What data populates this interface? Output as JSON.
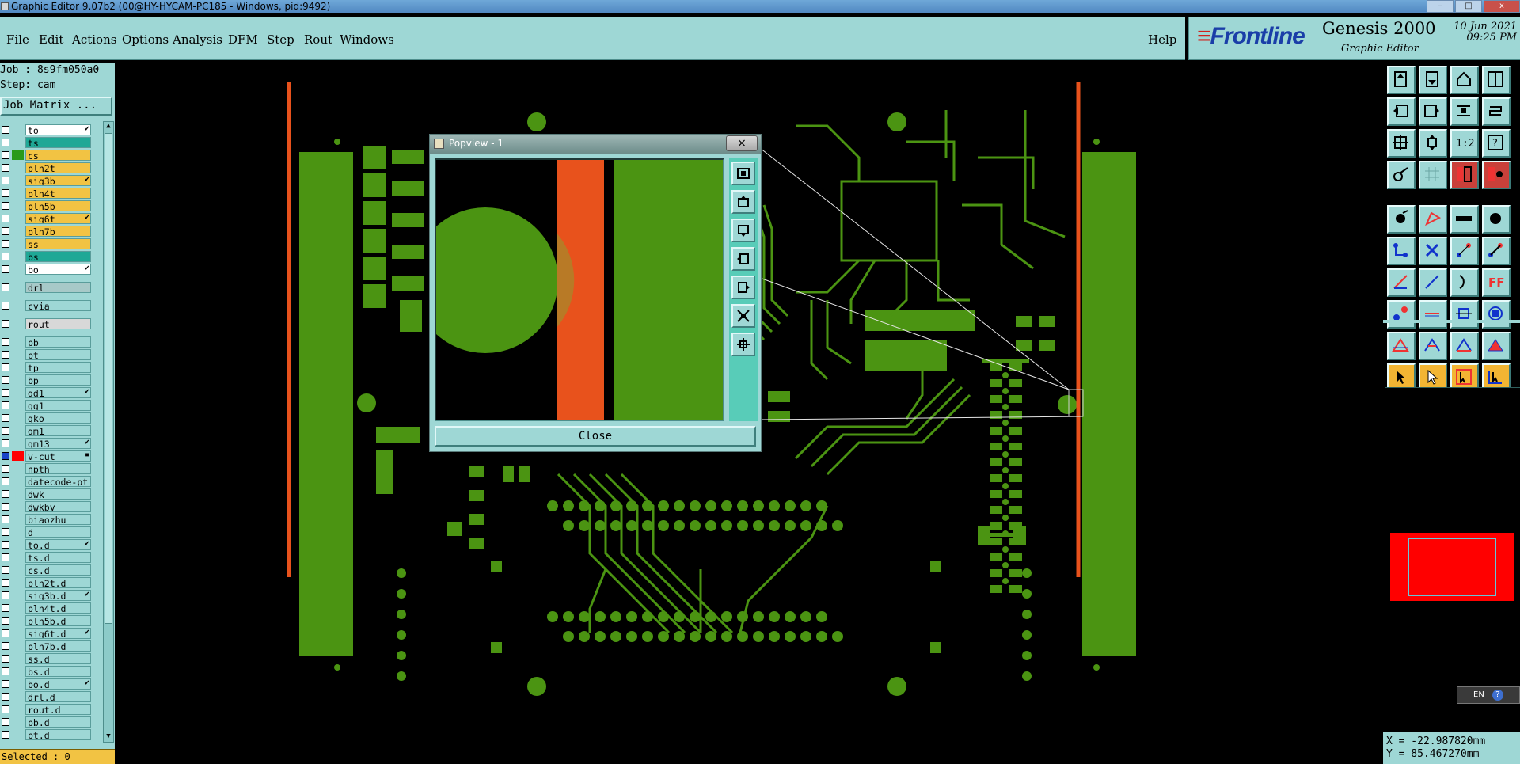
{
  "window": {
    "title": "Graphic Editor 9.07b2 (00@HY-HYCAM-PC185 - Windows, pid:9492)",
    "controls": [
      "–",
      "□",
      "x"
    ]
  },
  "menu": {
    "items": [
      "File",
      "Edit",
      "Actions",
      "Options",
      "Analysis",
      "DFM",
      "Step",
      "Rout",
      "Windows"
    ],
    "help": "Help"
  },
  "brand": {
    "logo": "Frontline",
    "product": "Genesis 2000",
    "subtitle": "Graphic Editor",
    "date": "10 Jun 2021",
    "time": "09:25 PM"
  },
  "job": {
    "job_label": "Job : 8s9fm050a0",
    "step_label": "Step: cam",
    "matrix_button": "Job Matrix ..."
  },
  "layers": [
    {
      "name": "to",
      "color": "#ffffff",
      "mark": "✔"
    },
    {
      "name": "ts",
      "color": "#1fa896",
      "mark": ""
    },
    {
      "name": "cs",
      "color": "#f2c343",
      "mark": "",
      "active": true
    },
    {
      "name": "pln2t",
      "color": "#f2c343",
      "mark": ""
    },
    {
      "name": "sig3b",
      "color": "#f2c343",
      "mark": "✔"
    },
    {
      "name": "pln4t",
      "color": "#f2c343",
      "mark": ""
    },
    {
      "name": "pln5b",
      "color": "#f2c343",
      "mark": ""
    },
    {
      "name": "sig6t",
      "color": "#f2c343",
      "mark": "✔"
    },
    {
      "name": "pln7b",
      "color": "#f2c343",
      "mark": ""
    },
    {
      "name": "ss",
      "color": "#f2c343",
      "mark": ""
    },
    {
      "name": "bs",
      "color": "#1fa896",
      "mark": ""
    },
    {
      "name": "bo",
      "color": "#ffffff",
      "mark": "✔"
    },
    {
      "name": "drl",
      "color": "#a7c9c8",
      "mark": "",
      "gap": true
    },
    {
      "name": "cvia",
      "color": "#9ed7d5",
      "mark": "",
      "gap": true
    },
    {
      "name": "rout",
      "color": "#d8d8d8",
      "mark": "",
      "gap": true
    },
    {
      "name": "pb",
      "color": "#9ed7d5",
      "mark": "",
      "gap": true
    },
    {
      "name": "pt",
      "color": "#9ed7d5",
      "mark": ""
    },
    {
      "name": "tp",
      "color": "#9ed7d5",
      "mark": ""
    },
    {
      "name": "bp",
      "color": "#9ed7d5",
      "mark": ""
    },
    {
      "name": "gd1",
      "color": "#9ed7d5",
      "mark": "✔"
    },
    {
      "name": "gg1",
      "color": "#9ed7d5",
      "mark": ""
    },
    {
      "name": "gko",
      "color": "#9ed7d5",
      "mark": ""
    },
    {
      "name": "gm1",
      "color": "#9ed7d5",
      "mark": ""
    },
    {
      "name": "gm13",
      "color": "#9ed7d5",
      "mark": "✔"
    },
    {
      "name": "v-cut",
      "color": "#9ed7d5",
      "mark": "▪",
      "selected": true
    },
    {
      "name": "npth",
      "color": "#9ed7d5",
      "mark": ""
    },
    {
      "name": "datecode-pt",
      "color": "#9ed7d5",
      "mark": ""
    },
    {
      "name": "dwk",
      "color": "#9ed7d5",
      "mark": ""
    },
    {
      "name": "dwkby",
      "color": "#9ed7d5",
      "mark": ""
    },
    {
      "name": "biaozhu",
      "color": "#9ed7d5",
      "mark": ""
    },
    {
      "name": "d",
      "color": "#9ed7d5",
      "mark": ""
    },
    {
      "name": "to.d",
      "color": "#9ed7d5",
      "mark": "✔"
    },
    {
      "name": "ts.d",
      "color": "#9ed7d5",
      "mark": ""
    },
    {
      "name": "cs.d",
      "color": "#9ed7d5",
      "mark": ""
    },
    {
      "name": "pln2t.d",
      "color": "#9ed7d5",
      "mark": ""
    },
    {
      "name": "sig3b.d",
      "color": "#9ed7d5",
      "mark": "✔"
    },
    {
      "name": "pln4t.d",
      "color": "#9ed7d5",
      "mark": ""
    },
    {
      "name": "pln5b.d",
      "color": "#9ed7d5",
      "mark": ""
    },
    {
      "name": "sig6t.d",
      "color": "#9ed7d5",
      "mark": "✔"
    },
    {
      "name": "pln7b.d",
      "color": "#9ed7d5",
      "mark": ""
    },
    {
      "name": "ss.d",
      "color": "#9ed7d5",
      "mark": ""
    },
    {
      "name": "bs.d",
      "color": "#9ed7d5",
      "mark": ""
    },
    {
      "name": "bo.d",
      "color": "#9ed7d5",
      "mark": "✔"
    },
    {
      "name": "drl.d",
      "color": "#9ed7d5",
      "mark": ""
    },
    {
      "name": "rout.d",
      "color": "#9ed7d5",
      "mark": ""
    },
    {
      "name": "pb.d",
      "color": "#9ed7d5",
      "mark": ""
    },
    {
      "name": "pt.d",
      "color": "#9ed7d5",
      "mark": ""
    }
  ],
  "selected_label": "Selected : 0",
  "popview": {
    "title": "Popview - 1",
    "close_x": "×",
    "close_button": "Close"
  },
  "toolbar": {
    "icons": [
      "layer-up-icon",
      "layer-down-icon",
      "home-icon",
      "window-icon",
      "pan-left-icon",
      "pan-right-icon",
      "zoom-fit-icon",
      "redraw-icon",
      "zoom-home-icon",
      "zoom-window-icon",
      "scale-1to2-icon",
      "help-icon",
      "measure-icon",
      "grid-icon",
      "snap-icon",
      "snap-center-icon",
      "add-pad-icon",
      "add-surface-icon",
      "add-line-icon",
      "add-circle-icon",
      "connect-icon",
      "delete-icon",
      "move-icon",
      "copy-icon",
      "add-arc-icon",
      "line-icon",
      "arc-icon",
      "text-icon",
      "feature-select-icon",
      "cut-icon",
      "resize-icon",
      "transform-icon",
      "polygon-icon",
      "polyline-icon",
      "outline-icon",
      "fill-icon",
      "select-icon",
      "select-add-icon",
      "select-box-icon",
      "select-net-icon"
    ]
  },
  "ime": {
    "label": "EN",
    "help": "?"
  },
  "coords": {
    "x": "X = -22.987820mm",
    "y": "Y = 85.467270mm"
  },
  "colors": {
    "panel": "#9ed7d5",
    "copper": "#4b9412",
    "rout": "#e8521c",
    "selected_layer": "#f2c343"
  }
}
